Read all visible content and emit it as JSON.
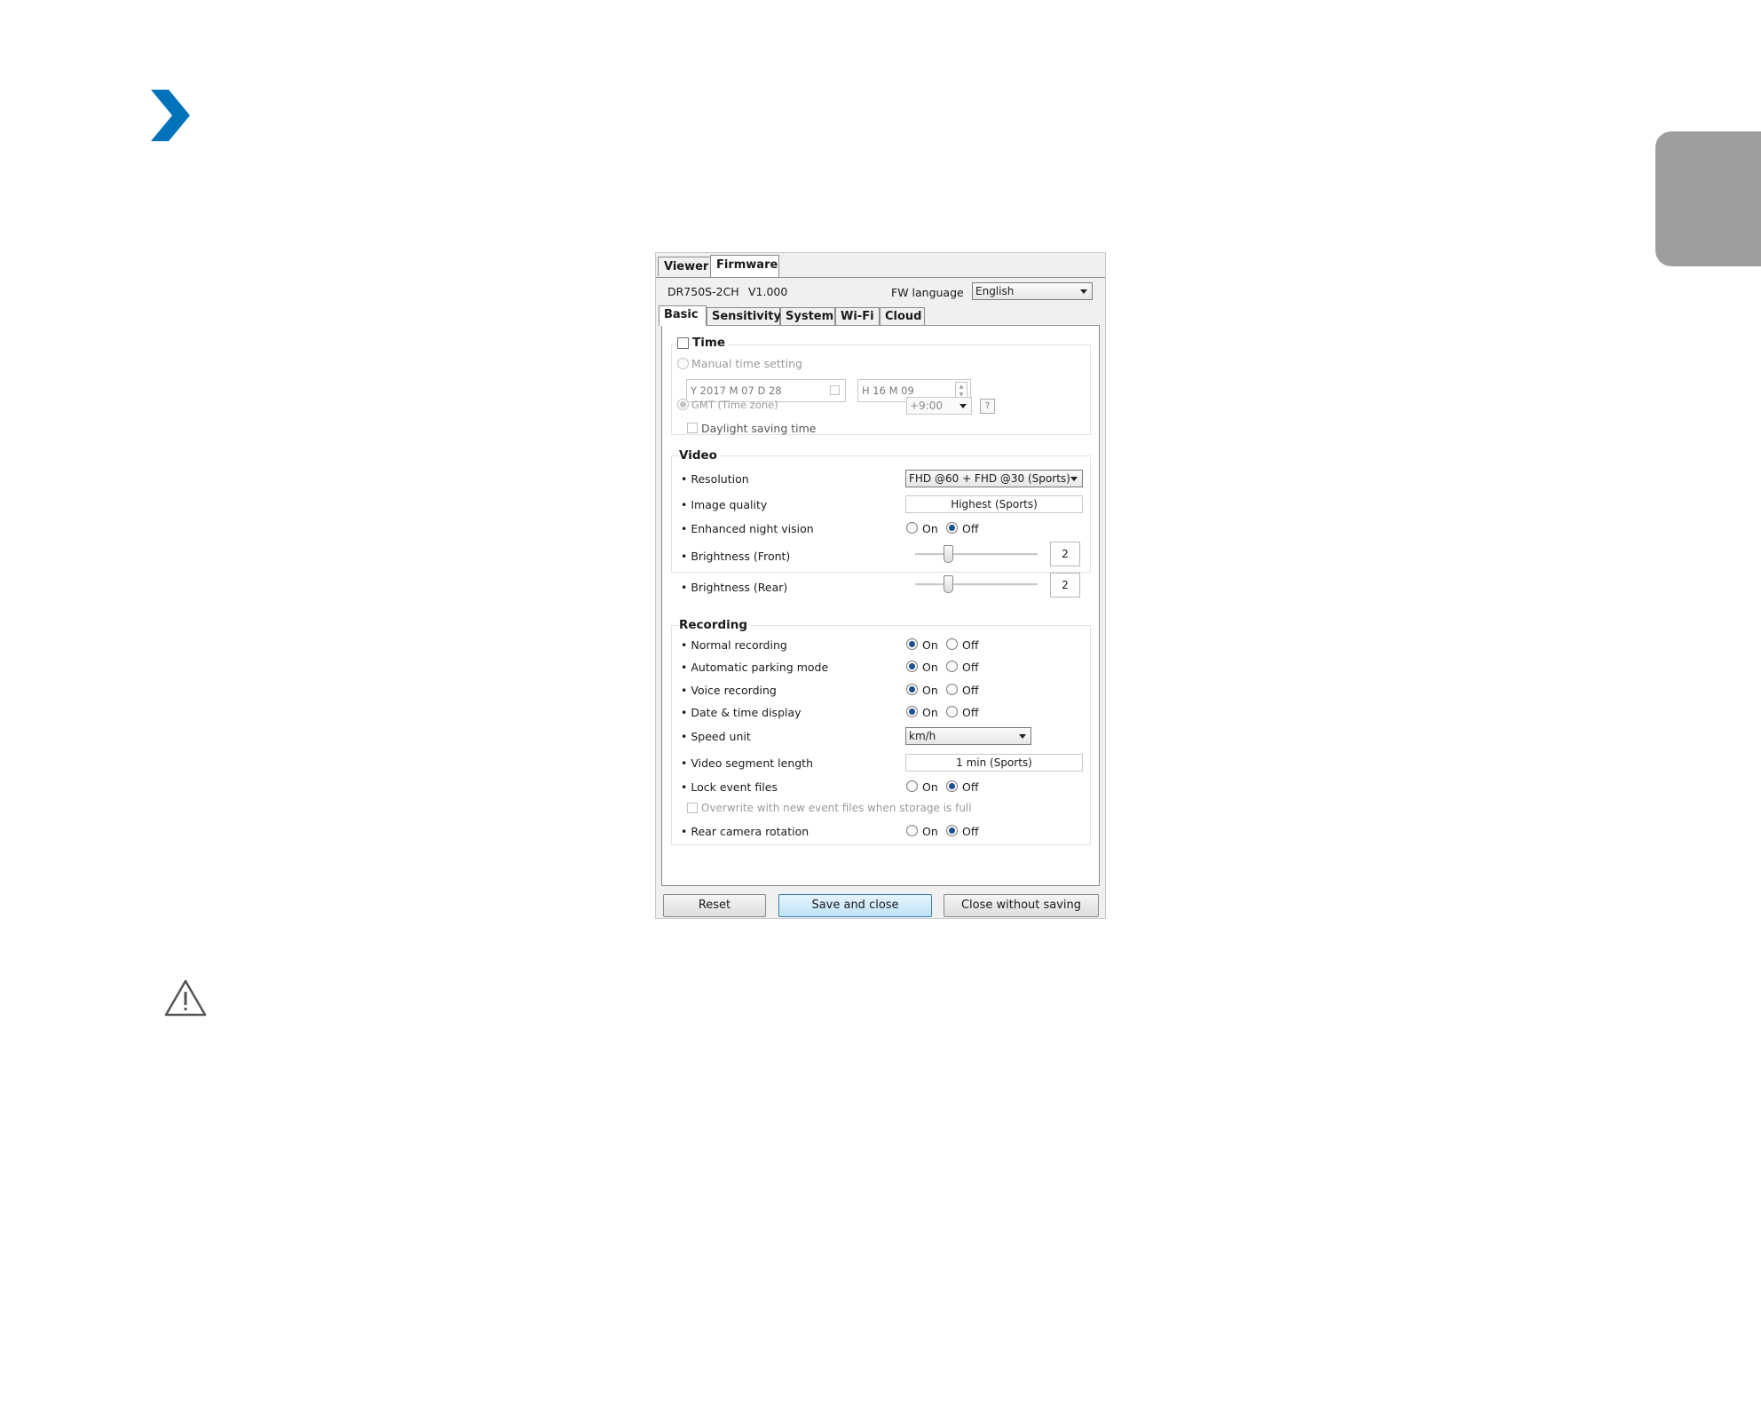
{
  "page": {
    "brand_color": "#0072bc",
    "icons": [
      "chevron-right-icon",
      "warning-icon"
    ]
  },
  "window": {
    "tabs": [
      "Viewer",
      "Firmware"
    ],
    "model": "DR750S-2CH",
    "version": "V1.000",
    "fw_language_label": "FW language",
    "fw_language_value": "English",
    "subtabs": [
      "Basic",
      "Sensitivity",
      "System",
      "Wi-Fi",
      "Cloud"
    ]
  },
  "time": {
    "title": "Time",
    "manual_label": "Manual time setting",
    "date_value": "Y 2017 M 07 D 28",
    "time_value": "H 16 M 09",
    "gmt_label": "GMT (Time zone)",
    "gmt_value": "+9:00",
    "help": "?",
    "dst_label": "Daylight saving time"
  },
  "video": {
    "title": "Video",
    "resolution_label": "Resolution",
    "resolution_value": "FHD @60 + FHD @30 (Sports)",
    "quality_label": "Image quality",
    "quality_value": "Highest (Sports)",
    "night_label": "Enhanced night vision",
    "on": "On",
    "off": "Off",
    "brightness_front_label": "Brightness (Front)",
    "brightness_front_value": "2",
    "brightness_rear_label": "Brightness (Rear)",
    "brightness_rear_value": "2"
  },
  "recording": {
    "title": "Recording",
    "normal_label": "Normal recording",
    "parking_label": "Automatic parking mode",
    "voice_label": "Voice recording",
    "datetime_label": "Date & time display",
    "speed_label": "Speed unit",
    "speed_value": "km/h",
    "segment_label": "Video segment length",
    "segment_value": "1 min (Sports)",
    "lock_label": "Lock event files",
    "overwrite_label": "Overwrite with new event files when storage is full",
    "rear_rotation_label": "Rear camera rotation",
    "on": "On",
    "off": "Off"
  },
  "buttons": {
    "reset": "Reset",
    "save": "Save and close",
    "close": "Close without saving"
  }
}
